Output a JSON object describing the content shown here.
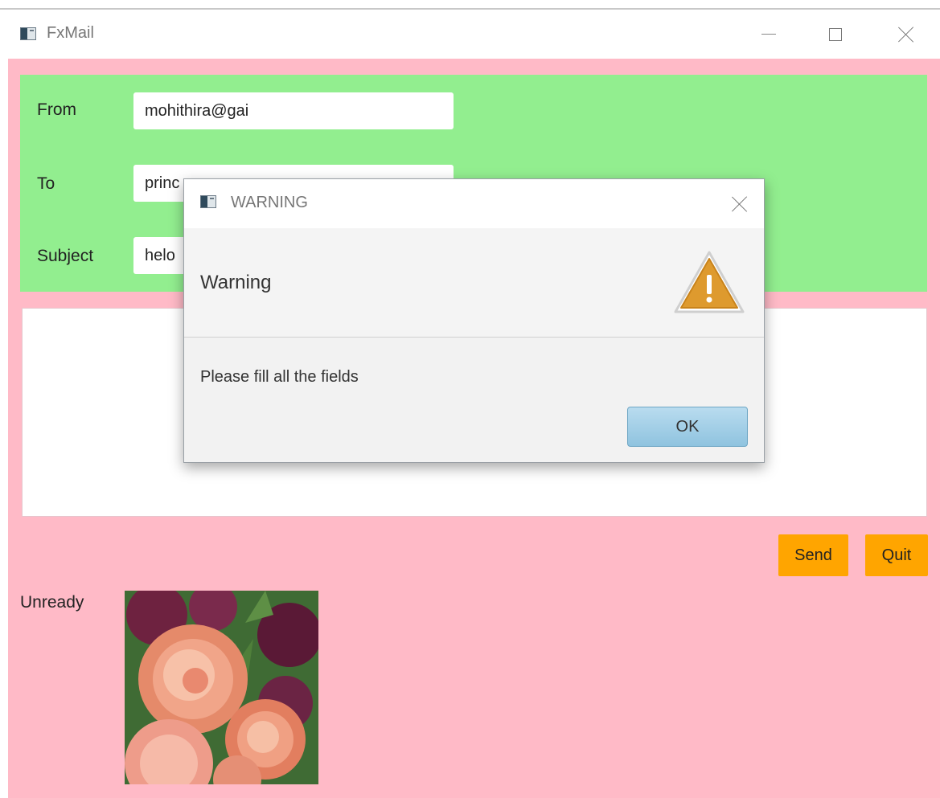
{
  "window": {
    "title": "FxMail",
    "icon": "app-window-icon",
    "controls": [
      "minimize-icon",
      "maximize-icon",
      "close-icon"
    ]
  },
  "form": {
    "from_label": "From",
    "from_value": "mohithira@gai",
    "to_label": "To",
    "to_value": "princ",
    "subject_label": "Subject",
    "subject_value": "helo"
  },
  "message_body": "",
  "buttons": {
    "send_label": "Send",
    "quit_label": "Quit"
  },
  "status_text": "Unready",
  "dialog": {
    "title": "WARNING",
    "header_text": "Warning",
    "content_text": "Please fill all the fields",
    "ok_label": "OK",
    "icon": "warning-icon"
  },
  "colors": {
    "background": "#ffbac7",
    "form_panel": "#92ee8f",
    "action_button": "#ffa500",
    "ok_button": "#a6d1e8"
  }
}
